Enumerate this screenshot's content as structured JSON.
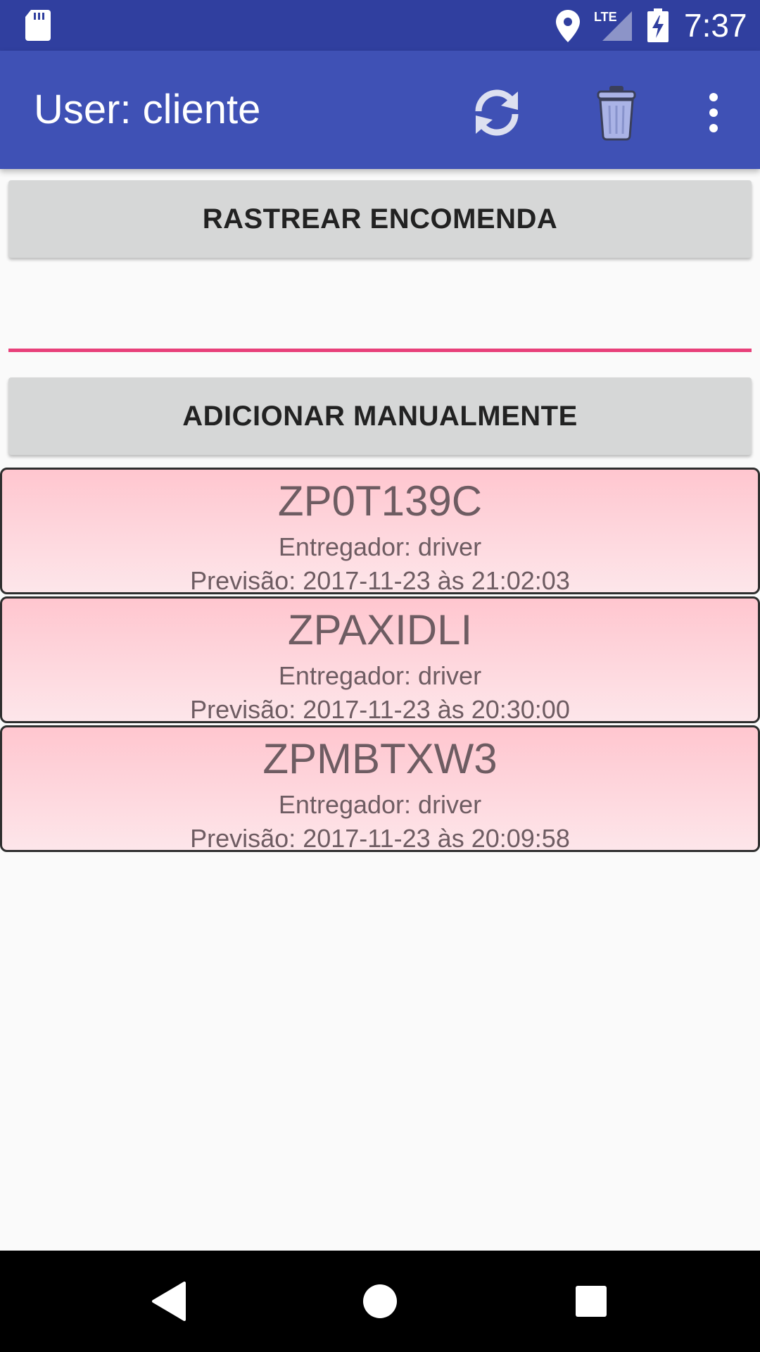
{
  "status_bar": {
    "time": "7:37",
    "network": "LTE",
    "icons": [
      "sd-card-icon",
      "location-icon",
      "signal-icon",
      "battery-charging-icon"
    ]
  },
  "app_bar": {
    "title": "User: cliente",
    "actions": [
      "refresh-icon",
      "trash-icon",
      "more-vert-icon"
    ]
  },
  "main": {
    "track_button_label": "RASTREAR ENCOMENDA",
    "code_input": {
      "value": "",
      "placeholder": ""
    },
    "add_button_label": "ADICIONAR MANUALMENTE",
    "orders": [
      {
        "code": "ZP0T139C",
        "driver": "Entregador: driver",
        "eta": "Previsão: 2017-11-23 às 21:02:03"
      },
      {
        "code": "ZPAXIDLI",
        "driver": "Entregador: driver",
        "eta": "Previsão: 2017-11-23 às 20:30:00"
      },
      {
        "code": "ZPMBTXW3",
        "driver": "Entregador: driver",
        "eta": "Previsão: 2017-11-23 às 20:09:58"
      }
    ]
  },
  "nav_bar": {
    "buttons": [
      "back-icon",
      "home-icon",
      "recents-icon"
    ]
  },
  "colors": {
    "status_bar": "#303f9f",
    "app_bar": "#3f51b5",
    "accent": "#e8407a",
    "card_top": "#ffc6cf",
    "card_bottom": "#fde6ea"
  }
}
